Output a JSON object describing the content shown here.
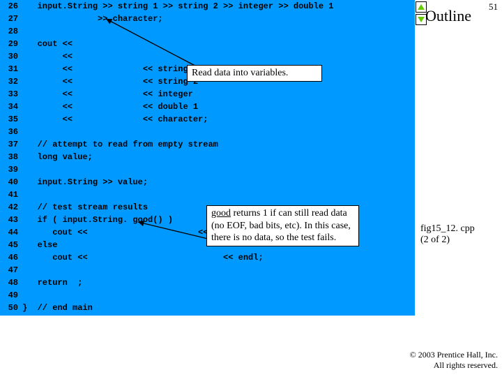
{
  "slide": {
    "number": "51",
    "outline_label": "Outline",
    "figure_label_line1": "fig15_12. cpp",
    "figure_label_line2": "(2 of 2)",
    "copyright_line1": "© 2003 Prentice Hall, Inc.",
    "copyright_line2": "All rights reserved."
  },
  "code": {
    "lines": [
      {
        "no": "26",
        "text": "   input.String >> string 1 >> string 2 >> integer >> double 1"
      },
      {
        "no": "27",
        "text": "               >> character;"
      },
      {
        "no": "28",
        "text": ""
      },
      {
        "no": "29",
        "text": "   cout <<"
      },
      {
        "no": "30",
        "text": "        <<"
      },
      {
        "no": "31",
        "text": "        <<              << string 1"
      },
      {
        "no": "32",
        "text": "        <<              << string 2"
      },
      {
        "no": "33",
        "text": "        <<              << integer"
      },
      {
        "no": "34",
        "text": "        <<              << double 1"
      },
      {
        "no": "35",
        "text": "        <<              << character;"
      },
      {
        "no": "36",
        "text": ""
      },
      {
        "no": "37",
        "text": "   // attempt to read from empty stream"
      },
      {
        "no": "38",
        "text": "   long value;"
      },
      {
        "no": "39",
        "text": ""
      },
      {
        "no": "40",
        "text": "   input.String >> value;"
      },
      {
        "no": "41",
        "text": ""
      },
      {
        "no": "42",
        "text": "   // test stream results"
      },
      {
        "no": "43",
        "text": "   if ( input.String. good() )"
      },
      {
        "no": "44",
        "text": "      cout <<                      << value << endl;"
      },
      {
        "no": "45",
        "text": "   else"
      },
      {
        "no": "46",
        "text": "      cout <<                           << endl;"
      },
      {
        "no": "47",
        "text": ""
      },
      {
        "no": "48",
        "text": "   return  ;"
      },
      {
        "no": "49",
        "text": ""
      },
      {
        "no": "50",
        "text": "}  // end main"
      }
    ]
  },
  "callouts": {
    "top": "Read data into variables.",
    "bottom_prefix": "good",
    "bottom_rest": " returns 1 if can still read data (no EOF, bad bits, etc). In this case, there is no data, so the test fails."
  },
  "chart_data": {
    "type": "table",
    "title": "Code listing fig15_12.cpp lines 26–50",
    "columns": [
      "line_number",
      "code"
    ],
    "rows": [
      [
        26,
        "input.String >> string 1 >> string 2 >> integer >> double 1"
      ],
      [
        27,
        "            >> character;"
      ],
      [
        28,
        ""
      ],
      [
        29,
        "cout <<"
      ],
      [
        30,
        "     <<"
      ],
      [
        31,
        "     <<              << string 1"
      ],
      [
        32,
        "     <<              << string 2"
      ],
      [
        33,
        "     <<              << integer"
      ],
      [
        34,
        "     <<              << double 1"
      ],
      [
        35,
        "     <<              << character;"
      ],
      [
        36,
        ""
      ],
      [
        37,
        "// attempt to read from empty stream"
      ],
      [
        38,
        "long value;"
      ],
      [
        39,
        ""
      ],
      [
        40,
        "input.String >> value;"
      ],
      [
        41,
        ""
      ],
      [
        42,
        "// test stream results"
      ],
      [
        43,
        "if ( input.String. good() )"
      ],
      [
        44,
        "   cout <<                      << value << endl;"
      ],
      [
        45,
        "else"
      ],
      [
        46,
        "   cout <<                           << endl;"
      ],
      [
        47,
        ""
      ],
      [
        48,
        "return  ;"
      ],
      [
        49,
        ""
      ],
      [
        50,
        "}  // end main"
      ]
    ]
  }
}
